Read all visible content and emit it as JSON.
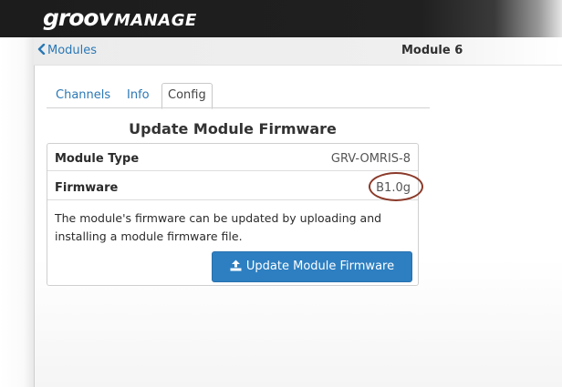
{
  "header": {
    "brand_part1": "groov",
    "brand_part2": "MANAGE"
  },
  "subnav": {
    "back_label": "Modules",
    "module_title": "Module 6"
  },
  "tabs": [
    {
      "label": "Channels",
      "active": false
    },
    {
      "label": "Info",
      "active": false
    },
    {
      "label": "Config",
      "active": true
    }
  ],
  "section": {
    "title": "Update Module Firmware"
  },
  "details": {
    "rows": [
      {
        "label": "Module Type",
        "value": "GRV-OMRIS-8"
      },
      {
        "label": "Firmware",
        "value": "B1.0g"
      }
    ],
    "description": "The module's firmware can be updated by uploading and installing a module firmware file.",
    "button_label": "Update Module Firmware"
  },
  "colors": {
    "accent": "#2d7fc1",
    "link": "#2a78b5",
    "highlight_ring": "#8b3a2a",
    "header_bg": "#1c1c1c"
  },
  "icons": {
    "back": "chevron-left-icon",
    "button": "upload-icon"
  }
}
